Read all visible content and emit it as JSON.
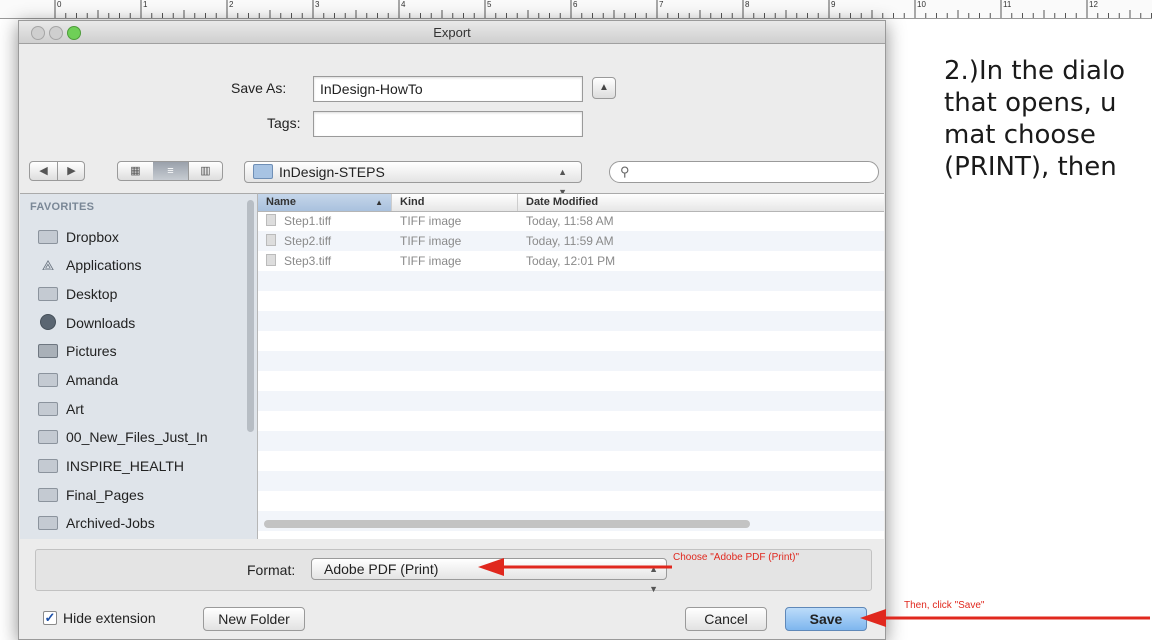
{
  "ruler": {
    "numbers": [
      "0",
      "1",
      "2",
      "3",
      "4",
      "5",
      "6",
      "7",
      "8",
      "9",
      "10",
      "11",
      "12"
    ]
  },
  "side_text": {
    "line1": "2.)In the dialo",
    "line2": "that opens, u",
    "line3": "mat choose",
    "line4": "(PRINT), then"
  },
  "window": {
    "title": "Export"
  },
  "save_as": {
    "label": "Save As:",
    "value": "InDesign-HowTo"
  },
  "tags": {
    "label": "Tags:",
    "value": ""
  },
  "location": {
    "folder": "InDesign-STEPS"
  },
  "search": {
    "icon": "magnifier-icon",
    "placeholder": ""
  },
  "sidebar": {
    "section": "FAVORITES",
    "items": [
      {
        "label": "Dropbox",
        "icon": "folder-icon"
      },
      {
        "label": "Applications",
        "icon": "applications-icon"
      },
      {
        "label": "Desktop",
        "icon": "desktop-icon"
      },
      {
        "label": "Downloads",
        "icon": "downloads-icon"
      },
      {
        "label": "Pictures",
        "icon": "camera-icon"
      },
      {
        "label": "Amanda",
        "icon": "folder-icon"
      },
      {
        "label": "Art",
        "icon": "folder-icon"
      },
      {
        "label": "00_New_Files_Just_In",
        "icon": "folder-icon"
      },
      {
        "label": "INSPIRE_HEALTH",
        "icon": "folder-icon"
      },
      {
        "label": "Final_Pages",
        "icon": "folder-icon"
      },
      {
        "label": "Archived-Jobs",
        "icon": "folder-icon"
      }
    ]
  },
  "file_list": {
    "columns": [
      "Name",
      "Kind",
      "Date Modified"
    ],
    "rows": [
      {
        "name": "Step1.tiff",
        "kind": "TIFF image",
        "date": "Today, 11:58 AM"
      },
      {
        "name": "Step2.tiff",
        "kind": "TIFF image",
        "date": "Today, 11:59 AM"
      },
      {
        "name": "Step3.tiff",
        "kind": "TIFF image",
        "date": "Today, 12:01 PM"
      }
    ]
  },
  "format": {
    "label": "Format:",
    "value": "Adobe PDF (Print)"
  },
  "footer": {
    "hide_extension": "Hide extension",
    "hide_extension_checked": true,
    "new_folder": "New Folder",
    "cancel": "Cancel",
    "save": "Save"
  },
  "annotations": {
    "choose": "Choose \"Adobe PDF (Print)\"",
    "then": "Then, click \"Save\""
  },
  "colors": {
    "annotation": "#e0281e",
    "default_button": "#7eb6ee"
  }
}
